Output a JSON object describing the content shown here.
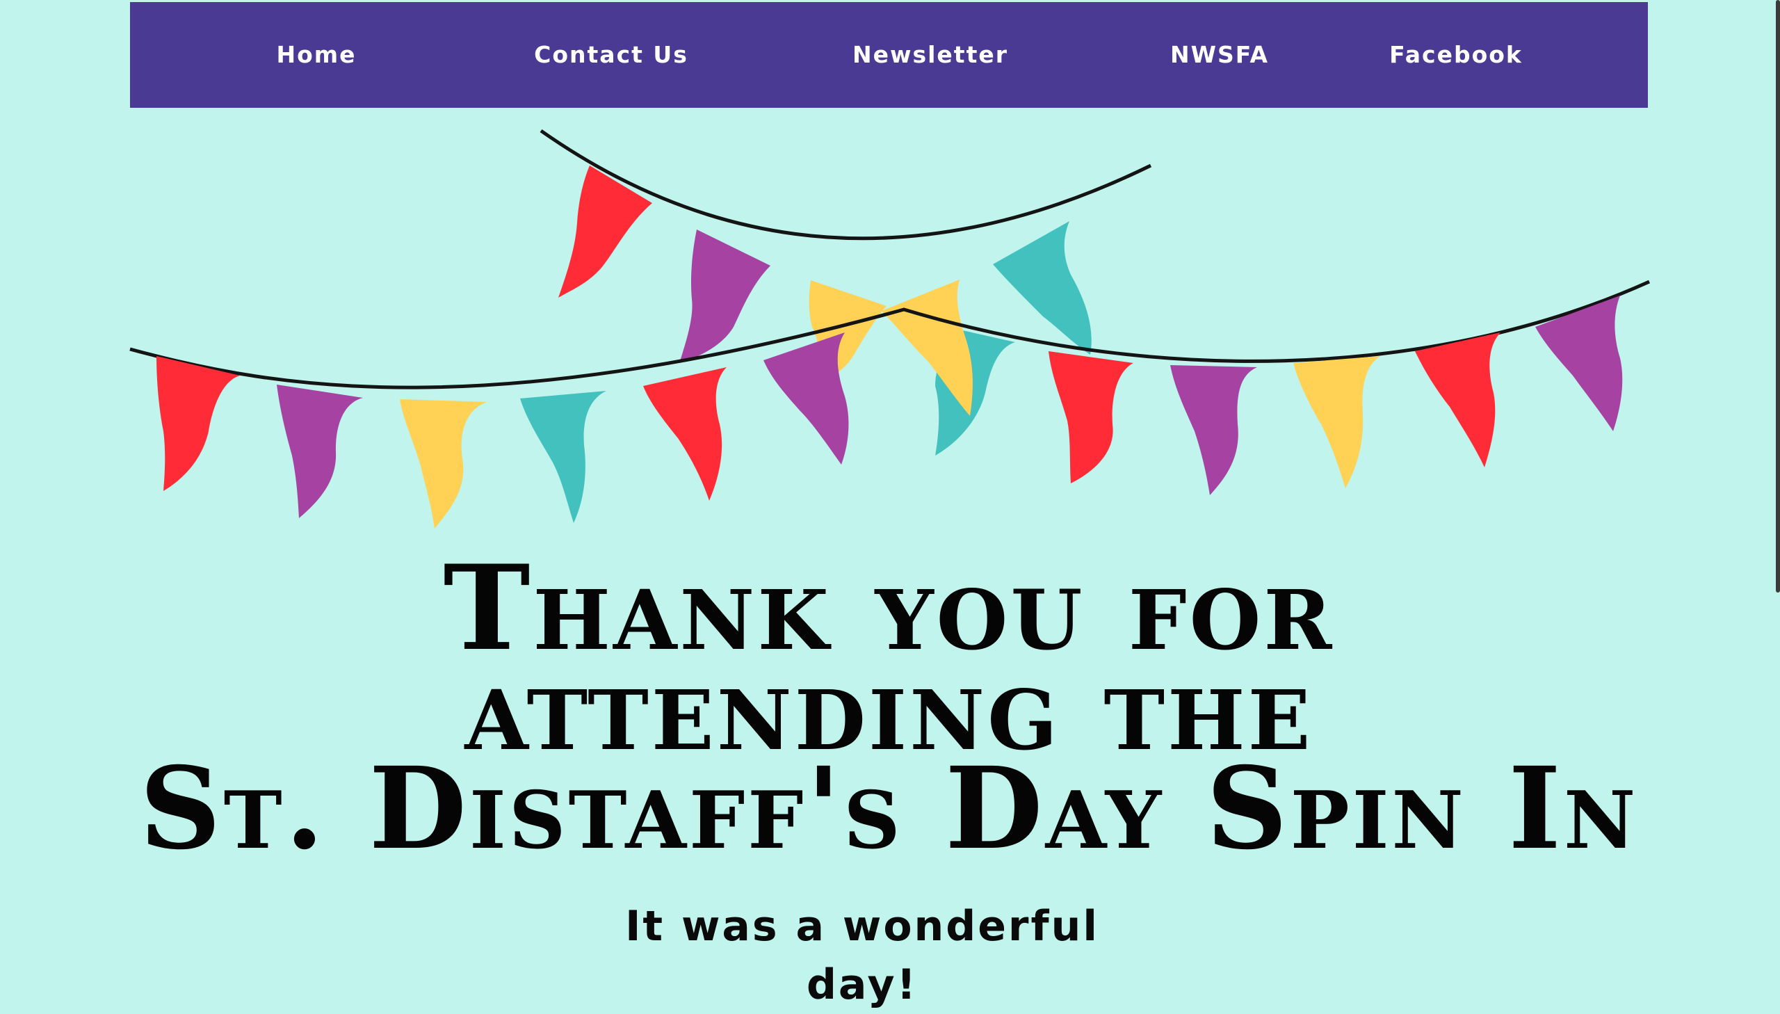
{
  "nav": {
    "items": [
      {
        "label": "Home"
      },
      {
        "label": "Contact Us"
      },
      {
        "label": "Newsletter"
      },
      {
        "label": "NWSFA"
      },
      {
        "label": "Facebook"
      }
    ]
  },
  "headline": {
    "line1": "Thank you for",
    "line2": "attending the",
    "line3": "St. Distaff's Day Spin In"
  },
  "subtext": "It was a wonderful day!",
  "colors": {
    "background": "#c0f4ec",
    "nav_background": "#4a3a93",
    "flag_red": "#ff2b37",
    "flag_purple": "#a542a2",
    "flag_yellow": "#ffd256",
    "flag_teal": "#43c1bf"
  },
  "decoration": {
    "icon": "bunting-flags-icon"
  }
}
